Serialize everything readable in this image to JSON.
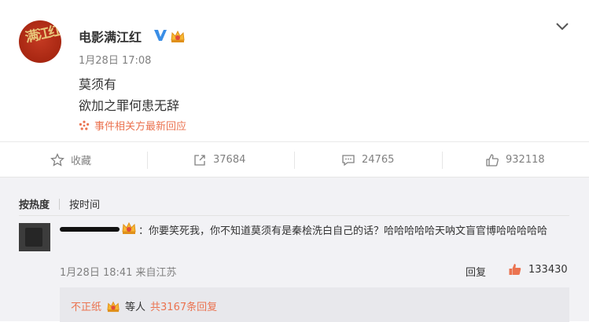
{
  "post": {
    "username": "电影满江红",
    "avatar_text": "满江红",
    "timestamp": "1月28日 17:08",
    "lines": [
      "莫须有",
      "欲加之罪何患无辞"
    ],
    "event_link": "事件相关方最新回应",
    "icons": [
      "verified-v-icon",
      "crown-badge-icon",
      "chevron-down-icon",
      "event-star-icon"
    ]
  },
  "actions": {
    "favorite_label": "收藏",
    "repost_count": "37684",
    "comment_count": "24765",
    "like_count": "932118"
  },
  "comments": {
    "sort_hot": "按热度",
    "sort_time": "按时间",
    "top_comment": {
      "text": "：你要笑死我，你不知道莫须有是秦桧洗白自己的话？哈哈哈哈哈天呐文盲官博哈哈哈哈哈",
      "time_source": "1月28日 18:41 来自江苏",
      "reply_label": "回复",
      "like_count": "133430"
    },
    "sub_reply": {
      "user": "不正纸",
      "middle": "等人",
      "total": "共3167条回复"
    }
  },
  "colors": {
    "accent_orange": "#eb7350",
    "verified_blue": "#3a8ee6",
    "text_gray": "#808080",
    "comment_bg": "#f2f2f5"
  }
}
